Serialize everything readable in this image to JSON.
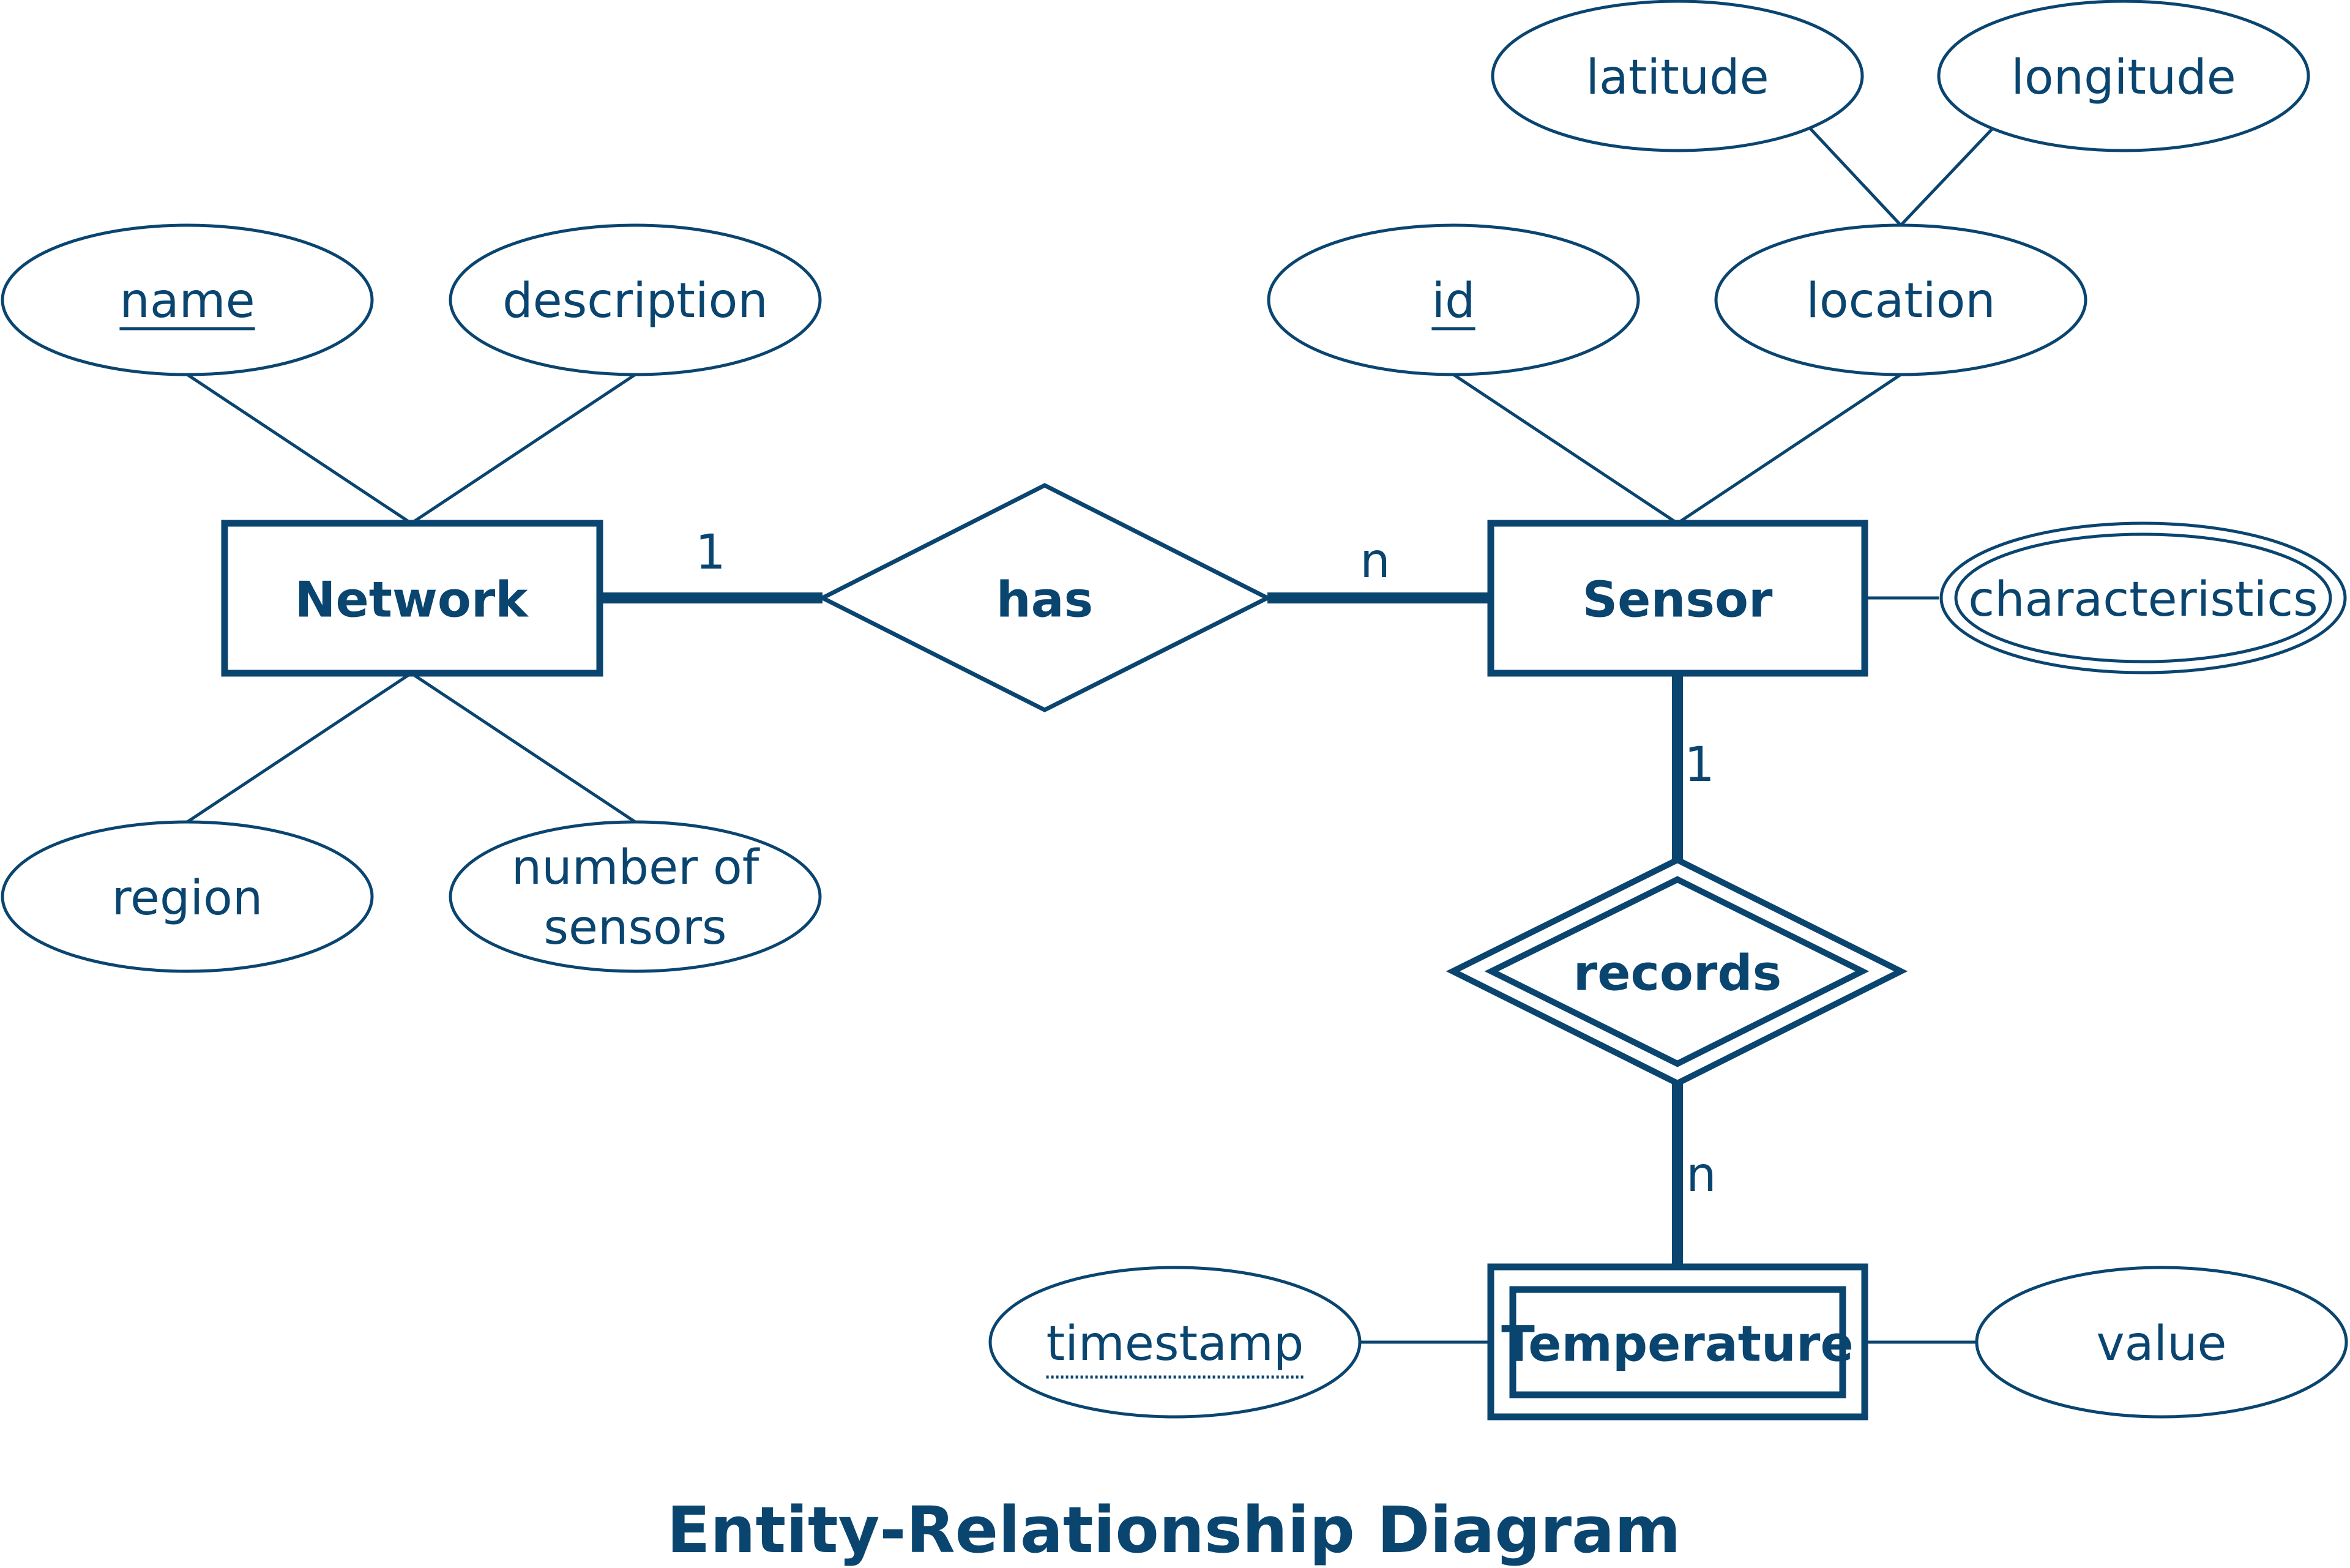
{
  "diagram": {
    "title": "Entity-Relationship Diagram",
    "colors": {
      "primary": "#0a4570",
      "background": "#ffffff"
    },
    "entities": {
      "network": {
        "label": "Network",
        "type": "strong"
      },
      "sensor": {
        "label": "Sensor",
        "type": "strong"
      },
      "temperature": {
        "label": "Temperature",
        "type": "weak"
      }
    },
    "relationships": {
      "has": {
        "label": "has",
        "type": "regular",
        "card_left": "1",
        "card_right": "n"
      },
      "records": {
        "label": "records",
        "type": "identifying",
        "card_top": "1",
        "card_bottom": "n"
      }
    },
    "attributes": {
      "name": {
        "label": "name",
        "kind": "key",
        "entity": "Network"
      },
      "description": {
        "label": "description",
        "kind": "simple",
        "entity": "Network"
      },
      "region": {
        "label": "region",
        "kind": "simple",
        "entity": "Network"
      },
      "number_of_sensors": {
        "label_line1": "number of",
        "label_line2": "sensors",
        "kind": "simple",
        "entity": "Network"
      },
      "id": {
        "label": "id",
        "kind": "key",
        "entity": "Sensor"
      },
      "location": {
        "label": "location",
        "kind": "composite",
        "entity": "Sensor"
      },
      "latitude": {
        "label": "latitude",
        "kind": "component",
        "parent": "location"
      },
      "longitude": {
        "label": "longitude",
        "kind": "component",
        "parent": "location"
      },
      "characteristics": {
        "label": "characteristics",
        "kind": "multivalued",
        "entity": "Sensor"
      },
      "timestamp": {
        "label": "timestamp",
        "kind": "partial-key",
        "entity": "Temperature"
      },
      "value": {
        "label": "value",
        "kind": "simple",
        "entity": "Temperature"
      }
    }
  }
}
